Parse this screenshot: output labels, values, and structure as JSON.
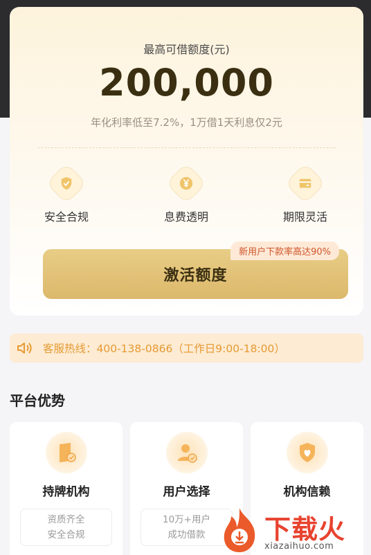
{
  "hero": {
    "label": "最高可借额度(元)",
    "amount": "200,000",
    "subtitle": "年化利率低至7.2%，1万借1天利息仅2元",
    "features": [
      {
        "label": "安全合规",
        "icon": "shield-check-icon"
      },
      {
        "label": "息费透明",
        "icon": "yen-icon"
      },
      {
        "label": "期限灵活",
        "icon": "card-icon"
      }
    ],
    "promo_badge": "新用户下款率高达90%",
    "activate_label": "激活额度"
  },
  "hotline": {
    "text": "客服热线：400-138-0866（工作日9:00-18:00）",
    "icon": "speaker-icon"
  },
  "advantages": {
    "title": "平台优势",
    "cards": [
      {
        "title": "持牌机构",
        "desc_line1": "资质齐全",
        "desc_line2": "安全合规",
        "icon": "license-icon"
      },
      {
        "title": "用户选择",
        "desc_line1": "10万+用户",
        "desc_line2": "成功借款",
        "icon": "user-check-icon"
      },
      {
        "title": "机构信赖",
        "desc_line1": "",
        "desc_line2": "",
        "icon": "shield-heart-icon"
      }
    ]
  },
  "watermark": {
    "brand": "下载火",
    "url": "xiazaihuo.com"
  },
  "colors": {
    "gold": "#dcb86b",
    "accent_orange": "#e69a32",
    "promo_red": "#d0542a",
    "brand_red": "#e8432f"
  }
}
